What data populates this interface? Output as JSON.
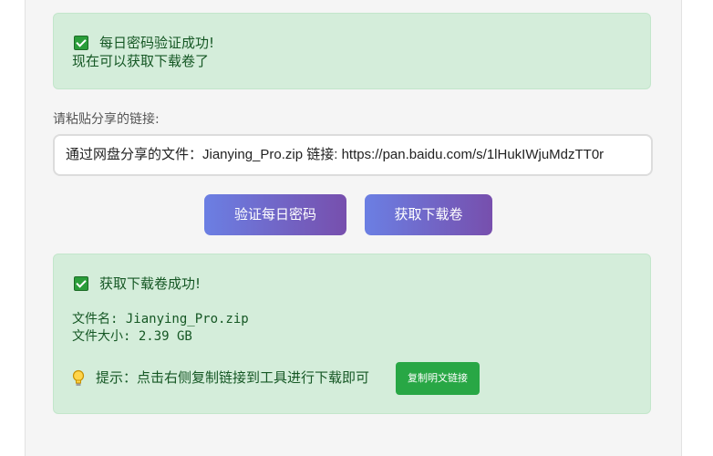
{
  "daily_alert": {
    "title": "每日密码验证成功!",
    "message": "现在可以获取下载卷了"
  },
  "share": {
    "label": "请粘贴分享的链接:",
    "input_value": "通过网盘分享的文件：Jianying_Pro.zip 链接: https://pan.baidu.com/s/1lHukIWjuMdzTT0r"
  },
  "buttons": {
    "verify": "验证每日密码",
    "get_volume": "获取下载卷"
  },
  "result_alert": {
    "title": "获取下载卷成功!",
    "file_name": "文件名: Jianying_Pro.zip",
    "file_size": "文件大小: 2.39 GB",
    "tip": "提示：点击右侧复制链接到工具进行下载即可",
    "copy_button": "复制明文链接"
  },
  "colors": {
    "alert_bg": "#d4edda",
    "alert_text": "#155724",
    "button_gradient_start": "#6b7fe3",
    "button_gradient_end": "#774fad",
    "copy_button_bg": "#28a745"
  },
  "icons": {
    "success": "check-box-icon",
    "tip": "lightbulb-icon"
  }
}
